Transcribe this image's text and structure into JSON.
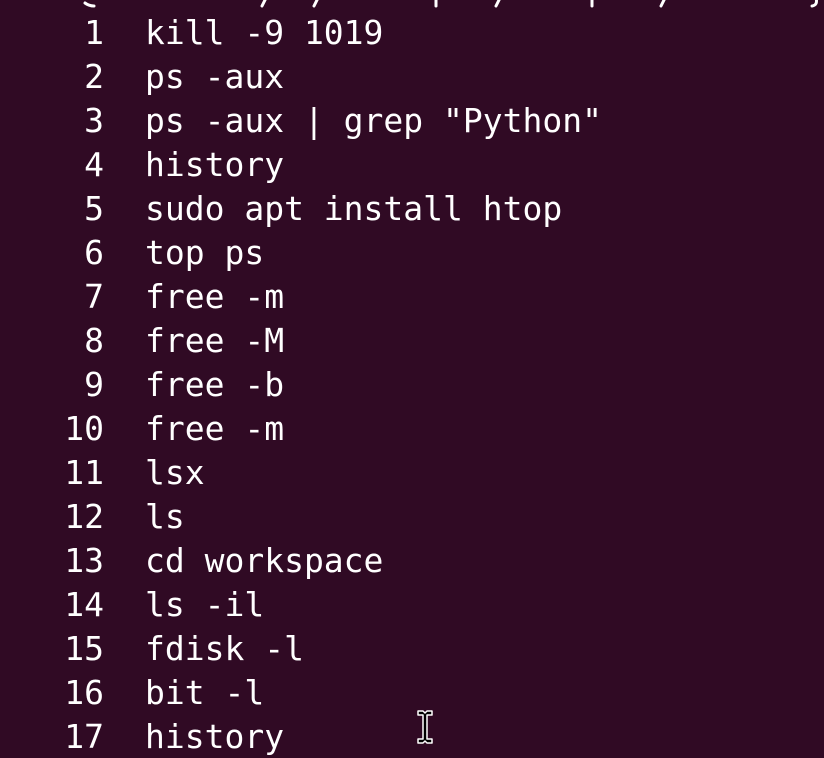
{
  "terminal": {
    "background_color": "#300a24",
    "text_color": "#ffffff",
    "history": [
      {
        "number": "1",
        "command": "kill -9 1019"
      },
      {
        "number": "2",
        "command": "ps -aux"
      },
      {
        "number": "3",
        "command": "ps -aux | grep \"Python\""
      },
      {
        "number": "4",
        "command": "history"
      },
      {
        "number": "5",
        "command": "sudo apt install htop"
      },
      {
        "number": "6",
        "command": "top ps"
      },
      {
        "number": "7",
        "command": "free -m"
      },
      {
        "number": "8",
        "command": "free -M"
      },
      {
        "number": "9",
        "command": "free -b"
      },
      {
        "number": "10",
        "command": "free -m"
      },
      {
        "number": "11",
        "command": "lsx"
      },
      {
        "number": "12",
        "command": "ls"
      },
      {
        "number": "13",
        "command": "cd workspace"
      },
      {
        "number": "14",
        "command": "ls -il"
      },
      {
        "number": "15",
        "command": "fdisk -l"
      },
      {
        "number": "16",
        "command": "bit -l"
      },
      {
        "number": "17",
        "command": "history"
      }
    ],
    "pointer_icon": "i-beam-cursor-icon"
  }
}
